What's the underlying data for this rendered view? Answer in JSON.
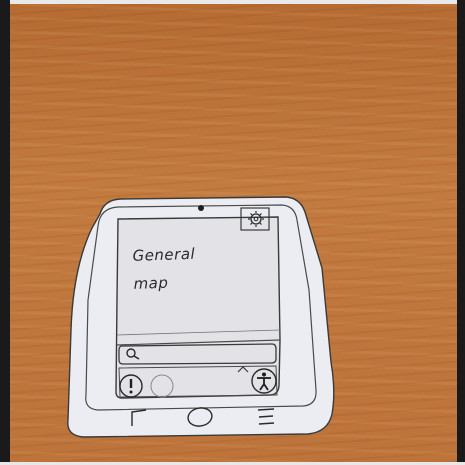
{
  "screen": {
    "map_title_lines": [
      "General",
      "map"
    ]
  },
  "search": {
    "icon": "search-icon"
  },
  "controls": {
    "report_icon": "exclamation-icon",
    "accessibility_icon": "accessibility-person-icon",
    "settings_icon": "gear-icon",
    "expand_icon": "caret-up-icon"
  },
  "nav": {
    "back_icon": "back-icon",
    "home_icon": "home-icon",
    "menu_icon": "menu-icon"
  },
  "colors": {
    "paper": "#ecedf2",
    "screen": "#e3e3e7",
    "ink": "#2b2b2b",
    "desk": "#bf763c"
  }
}
